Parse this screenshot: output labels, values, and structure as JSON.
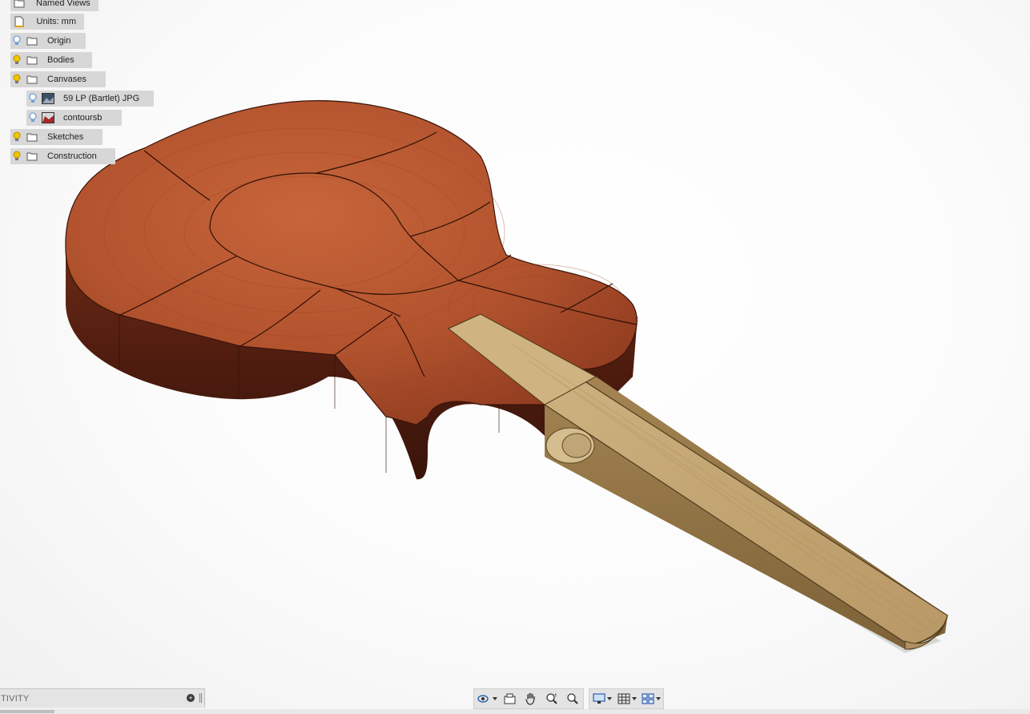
{
  "browser": {
    "items": [
      {
        "label": "Named Views",
        "icon": "folder-icon",
        "bulb": false,
        "indent": 0,
        "kind": "folder"
      },
      {
        "label": "Units: mm",
        "icon": "document-icon",
        "bulb": false,
        "indent": 0,
        "kind": "doc"
      },
      {
        "label": "Origin",
        "icon": "folder-icon",
        "bulb": "off",
        "indent": 0,
        "kind": "folder"
      },
      {
        "label": "Bodies",
        "icon": "folder-icon",
        "bulb": "on",
        "indent": 0,
        "kind": "folder"
      },
      {
        "label": "Canvases",
        "icon": "folder-icon",
        "bulb": "on",
        "indent": 0,
        "kind": "folder"
      },
      {
        "label": "59 LP (Bartlet) JPG",
        "icon": "image-canvas-icon",
        "bulb": "off",
        "indent": 1,
        "kind": "canvas"
      },
      {
        "label": "contoursb",
        "icon": "image-canvas-icon",
        "bulb": "off",
        "indent": 1,
        "kind": "canvas"
      },
      {
        "label": "Sketches",
        "icon": "folder-icon",
        "bulb": "on",
        "indent": 0,
        "kind": "folder"
      },
      {
        "label": "Construction",
        "icon": "folder-icon",
        "bulb": "on",
        "indent": 0,
        "kind": "folder"
      }
    ]
  },
  "activity": {
    "label": "TIVITY",
    "add_icon": "plus-circle-icon"
  },
  "nav_toolbar": {
    "groups": [
      [
        "orbit-icon",
        "look-at-icon",
        "pan-hand-icon",
        "zoom-icon",
        "fit-icon"
      ],
      [
        "display-settings-icon",
        "grid-settings-icon",
        "viewports-icon"
      ]
    ]
  },
  "colors": {
    "panel_bg": "#d7d7d7",
    "bulb_on": "#f2c500",
    "bulb_off": "#6f9fd8",
    "body_wood": "#b5562f",
    "neck_wood": "#c9ad7d"
  }
}
